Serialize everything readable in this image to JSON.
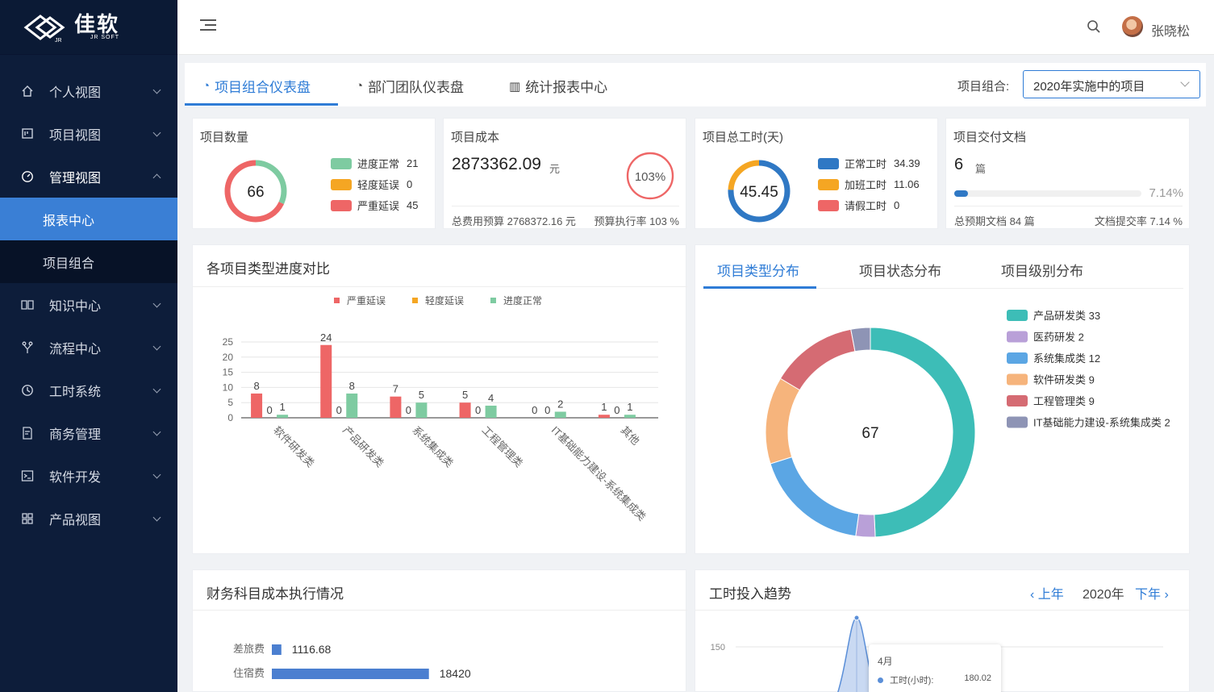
{
  "brand": {
    "name": "佳软",
    "sub": "JR SOFT",
    "mark": "JR"
  },
  "sidebar": {
    "items": [
      {
        "label": "个人视图",
        "icon": "home-icon"
      },
      {
        "label": "项目视图",
        "icon": "board-icon"
      },
      {
        "label": "管理视图",
        "icon": "dashboard-icon"
      },
      {
        "label": "知识中心",
        "icon": "book-icon"
      },
      {
        "label": "流程中心",
        "icon": "flow-icon"
      },
      {
        "label": "工时系统",
        "icon": "clock-icon"
      },
      {
        "label": "商务管理",
        "icon": "contract-icon"
      },
      {
        "label": "软件开发",
        "icon": "terminal-icon"
      },
      {
        "label": "产品视图",
        "icon": "grid-icon"
      }
    ],
    "sub_items": [
      {
        "label": "报表中心"
      },
      {
        "label": "项目组合"
      }
    ]
  },
  "header": {
    "username": "张晓松"
  },
  "tabs": [
    {
      "label": "项目组合仪表盘"
    },
    {
      "label": "部门团队仪表盘"
    },
    {
      "label": "统计报表中心"
    }
  ],
  "portfolio": {
    "label": "项目组合:",
    "value": "2020年实施中的项目"
  },
  "cards": {
    "count": {
      "title": "项目数量",
      "total": "66",
      "legend": [
        {
          "label": "进度正常",
          "value": "21",
          "color": "#7ecba1"
        },
        {
          "label": "轻度延误",
          "value": "0",
          "color": "#f5a623"
        },
        {
          "label": "严重延误",
          "value": "45",
          "color": "#ee6666"
        }
      ]
    },
    "cost": {
      "title": "项目成本",
      "amount": "2873362.09",
      "unit": "元",
      "rate": "103%",
      "budget": "总费用预算 2768372.16 元",
      "execution": "预算执行率 103 %"
    },
    "hours": {
      "title": "项目总工时(天)",
      "total": "45.45",
      "legend": [
        {
          "label": "正常工时",
          "value": "34.39",
          "color": "#2f78c4"
        },
        {
          "label": "加班工时",
          "value": "11.06",
          "color": "#f5a623"
        },
        {
          "label": "请假工时",
          "value": "0",
          "color": "#ee6666"
        }
      ]
    },
    "docs": {
      "title": "项目交付文档",
      "count": "6",
      "unit": "篇",
      "percent": "7.14%",
      "fill": 0.0714,
      "expected": "总预期文档 84 篇",
      "rate": "文档提交率 7.14 %"
    }
  },
  "progress_panel": {
    "title": "各项目类型进度对比"
  },
  "dist_panel": {
    "tabs": [
      {
        "label": "项目类型分布"
      },
      {
        "label": "项目状态分布"
      },
      {
        "label": "项目级别分布"
      }
    ],
    "total": "67"
  },
  "finance_panel": {
    "title": "财务科目成本执行情况"
  },
  "trend_panel": {
    "title": "工时投入趋势",
    "prev": "上年",
    "year": "2020年",
    "next": "下年",
    "tooltip": {
      "month": "4月",
      "series": "工时(小时):",
      "value": "180.02"
    }
  },
  "chart_data": [
    {
      "type": "bar",
      "title": "各项目类型进度对比",
      "categories": [
        "软件研发类",
        "产品研发类",
        "系统集成类",
        "工程管理类",
        "IT基础能力建设-系统集成类",
        "其他"
      ],
      "series": [
        {
          "name": "严重延误",
          "color": "#ee6666",
          "values": [
            8,
            24,
            7,
            5,
            0,
            1
          ]
        },
        {
          "name": "轻度延误",
          "color": "#f5a623",
          "values": [
            0,
            0,
            0,
            0,
            0,
            0
          ]
        },
        {
          "name": "进度正常",
          "color": "#7ecba1",
          "values": [
            1,
            8,
            5,
            4,
            2,
            1
          ]
        }
      ],
      "yticks": [
        "0",
        "5",
        "10",
        "15",
        "20",
        "25"
      ],
      "ylim": [
        0,
        25
      ],
      "legend": "top-center"
    },
    {
      "type": "pie",
      "title": "项目类型分布",
      "total": "67",
      "slices": [
        {
          "name": "产品研发类",
          "value": 33,
          "color": "#3dbdb7"
        },
        {
          "name": "医药研发",
          "value": 2,
          "color": "#b9a0d8"
        },
        {
          "name": "系统集成类",
          "value": 12,
          "color": "#5ba6e4"
        },
        {
          "name": "软件研发类",
          "value": 9,
          "color": "#f6b47c"
        },
        {
          "name": "工程管理类",
          "value": 9,
          "color": "#d56b73"
        },
        {
          "name": "IT基础能力建设-系统集成类",
          "value": 2,
          "color": "#8e94b5"
        }
      ],
      "legend": "right"
    },
    {
      "type": "bar",
      "title": "财务科目成本执行情况",
      "orientation": "horizontal",
      "categories": [
        "差旅费",
        "住宿费"
      ],
      "values": [
        1116.68,
        18420
      ],
      "labels": [
        "1116.68",
        "18420"
      ],
      "xlim": [
        0,
        35000
      ],
      "color": "#4b7fd0"
    },
    {
      "type": "area",
      "title": "工时投入趋势",
      "yticks": [
        "150"
      ],
      "peak": {
        "x": "4月",
        "y": 180.02
      },
      "color": "#5b8fd8"
    }
  ]
}
